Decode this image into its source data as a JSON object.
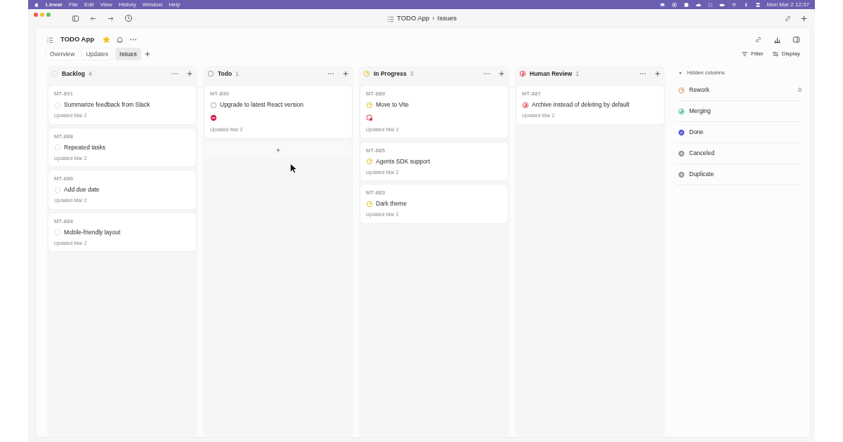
{
  "menu_bar": {
    "app": "Linear",
    "items": [
      "File",
      "Edit",
      "View",
      "History",
      "Window",
      "Help"
    ],
    "clock": "Mon Mar 2  12:37"
  },
  "window": {
    "title_project": "TODO App",
    "title_sep": "›",
    "title_page": "Issues"
  },
  "project": {
    "name": "TODO App",
    "starred": true
  },
  "tabs": [
    {
      "label": "Overview",
      "selected": false
    },
    {
      "label": "Updates",
      "selected": false
    },
    {
      "label": "Issues",
      "selected": true
    }
  ],
  "toolbar": {
    "filter": "Filter",
    "display": "Display"
  },
  "columns": [
    {
      "name": "Backlog",
      "kind": "backlog",
      "count": "4",
      "add_row": false,
      "cards": [
        {
          "id": "MT-891",
          "title": "Summarize feedback from Slack",
          "kind": "backlog",
          "updated": "Updated Mar 2"
        },
        {
          "id": "MT-888",
          "title": "Repeated tasks",
          "kind": "backlog",
          "updated": "Updated Mar 2"
        },
        {
          "id": "MT-886",
          "title": "Add due date",
          "kind": "backlog",
          "updated": "Updated Mar 2"
        },
        {
          "id": "MT-884",
          "title": "Mobile-friendly layout",
          "kind": "backlog",
          "updated": "Updated Mar 2"
        }
      ]
    },
    {
      "name": "Todo",
      "kind": "todo",
      "count": "1",
      "add_row": true,
      "cards": [
        {
          "id": "MT-890",
          "title": "Upgrade to latest React version",
          "kind": "todo",
          "marker": {
            "kind": "blocked"
          },
          "updated": "Updated Mar 2"
        }
      ]
    },
    {
      "name": "In Progress",
      "kind": "started",
      "count": "3",
      "add_row": false,
      "cards": [
        {
          "id": "MT-889",
          "title": "Move to Vite",
          "kind": "started",
          "marker": {
            "kind": "blocking"
          },
          "updated": "Updated Mar 2"
        },
        {
          "id": "MT-885",
          "title": "Agents SDK support",
          "kind": "started",
          "updated": "Updated Mar 2"
        },
        {
          "id": "MT-883",
          "title": "Dark theme",
          "kind": "started",
          "updated": "Updated Mar 2"
        }
      ]
    },
    {
      "name": "Human Review",
      "kind": "review",
      "count": "1",
      "add_row": false,
      "cards": [
        {
          "id": "MT-887",
          "title": "Archive instead of deleting by default",
          "kind": "review",
          "updated": "Updated Mar 2"
        }
      ]
    }
  ],
  "hidden_columns": {
    "title": "Hidden columns",
    "expanded": true,
    "items": [
      {
        "name": "Rework",
        "kind": "rework",
        "count": "0"
      },
      {
        "name": "Merging",
        "kind": "merging"
      },
      {
        "name": "Done",
        "kind": "done"
      },
      {
        "name": "Canceled",
        "kind": "canceled"
      },
      {
        "name": "Duplicate",
        "kind": "duplicate"
      }
    ]
  }
}
